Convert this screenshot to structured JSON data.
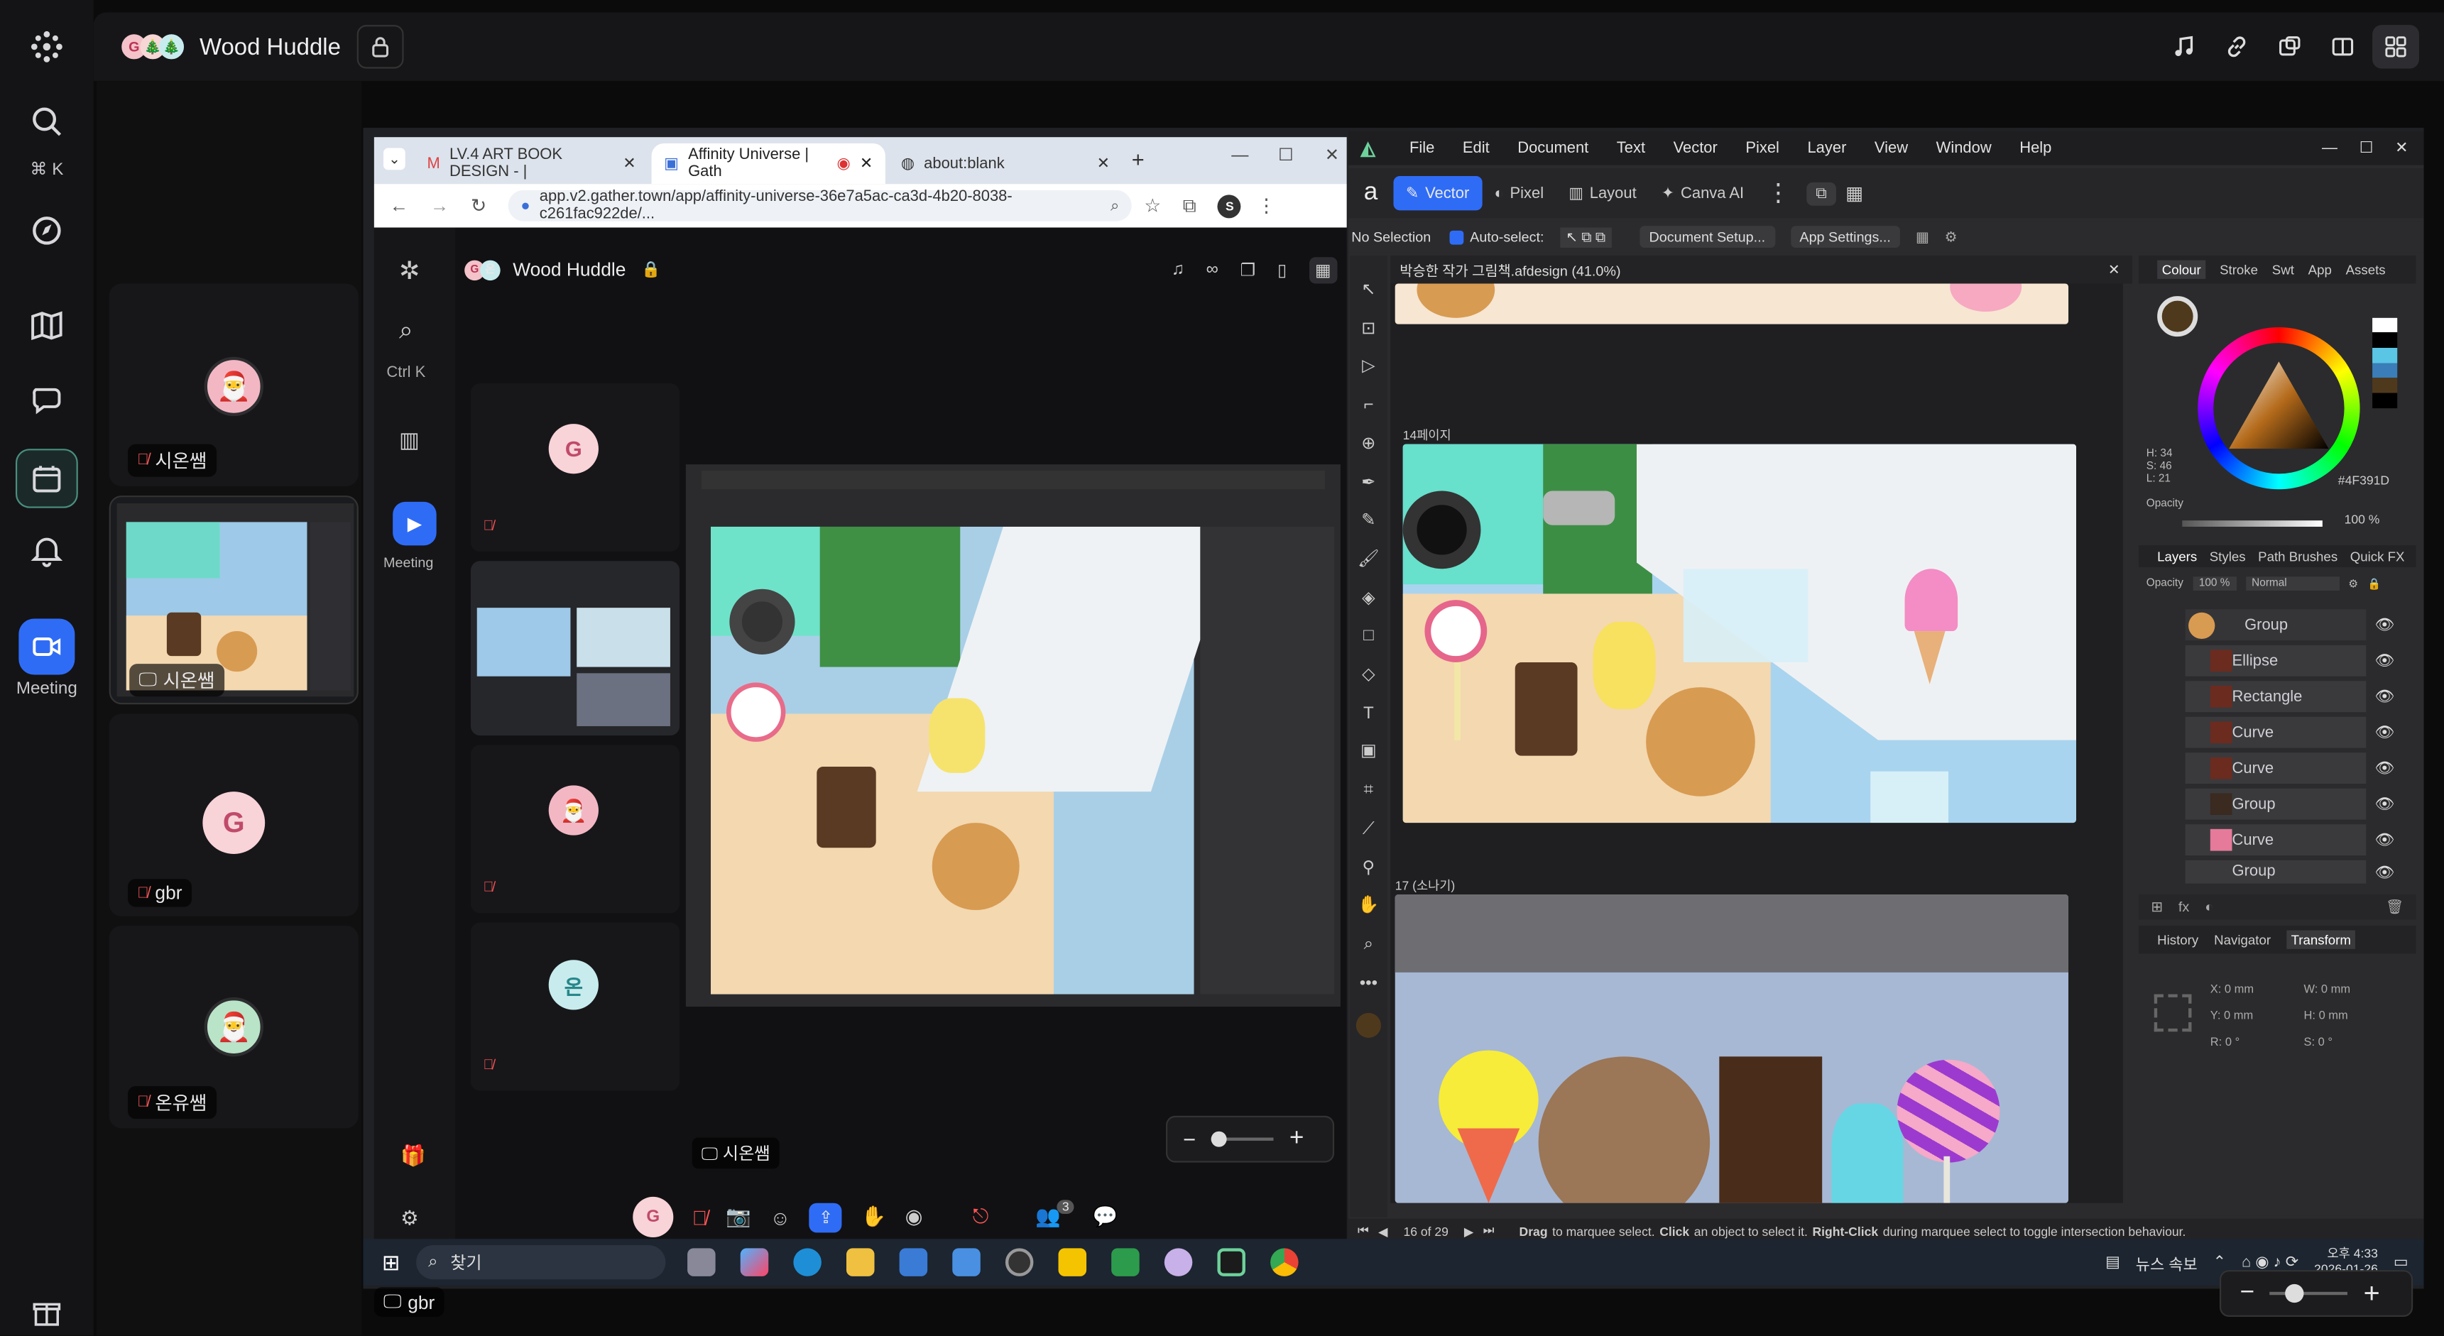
{
  "app": {
    "room_name": "Wood Huddle",
    "shortcut_mac": "⌘ K",
    "shortcut_win": "Ctrl K",
    "meeting_label": "Meeting"
  },
  "participants": [
    {
      "name": "시온쌤"
    },
    {
      "name": "gbr",
      "initial": "G"
    },
    {
      "name": "온유쌤"
    }
  ],
  "share_label": "시온쌤",
  "self_label": "gbr",
  "browser": {
    "tabs": [
      {
        "label": "LV.4 ART BOOK DESIGN - |"
      },
      {
        "label": "Affinity Universe | Gath"
      },
      {
        "label": "about:blank"
      }
    ],
    "url": "app.v2.gather.town/app/affinity-universe-36e7a5ac-ca3d-4b20-8038-c261fac922de/...",
    "profile_initial": "S"
  },
  "inner": {
    "room_name": "Wood Huddle",
    "participants": [
      {
        "initial": "G"
      },
      {
        "initial": "온"
      }
    ],
    "share_label": "시온쌤",
    "self_initial": "G",
    "people_count": "3"
  },
  "affinity": {
    "menu": [
      "File",
      "Edit",
      "Document",
      "Text",
      "Vector",
      "Pixel",
      "Layer",
      "View",
      "Window",
      "Help"
    ],
    "personas": [
      "Vector",
      "Pixel",
      "Layout",
      "Canva AI"
    ],
    "context": {
      "no_selection": "No Selection",
      "auto_select": "Auto-select:",
      "doc_setup": "Document Setup...",
      "app_settings": "App Settings..."
    },
    "doc_title": "박승한 작가 그림책.afdesign (41.0%)",
    "page14": "14페이지",
    "page17": "17 (소나기)",
    "panel_tabs": [
      "Colour",
      "Stroke",
      "Swt",
      "App",
      "Assets"
    ],
    "color_readout": {
      "h": "H: 34",
      "s": "S: 46",
      "l": "L: 21",
      "hex": "4F391D"
    },
    "opacity_label": "Opacity",
    "opacity_value": "100 %",
    "layer_tabs": [
      "Layers",
      "Styles",
      "Path Brushes",
      "Quick FX"
    ],
    "layer_opacity": "Opacity",
    "layer_opacity_value": "100 %",
    "blend": "Normal",
    "layers": [
      "Group",
      "Ellipse",
      "Rectangle",
      "Curve",
      "Curve",
      "Group",
      "Curve",
      "Group"
    ],
    "bottom_tabs": [
      "History",
      "Navigator",
      "Transform"
    ],
    "transform": {
      "x": "0 mm",
      "y": "0 mm",
      "w": "0 mm",
      "h": "0 mm",
      "r": "0 °",
      "s": "0 °"
    },
    "page_counter": "16 of 29",
    "status": {
      "drag": "Drag",
      "t1": "to marquee select.",
      "click": "Click",
      "t2": "an object to select it.",
      "rclick": "Right-Click",
      "t3": "during marquee select to toggle intersection behaviour."
    }
  },
  "taskbar": {
    "search": "찾기",
    "news": "뉴스 속보",
    "time": "오후 4:33",
    "date": "2026-01-26"
  },
  "colors": {
    "accent": "#2f6cf6",
    "rail": "#141416",
    "affinity": "#2b2b2d"
  }
}
